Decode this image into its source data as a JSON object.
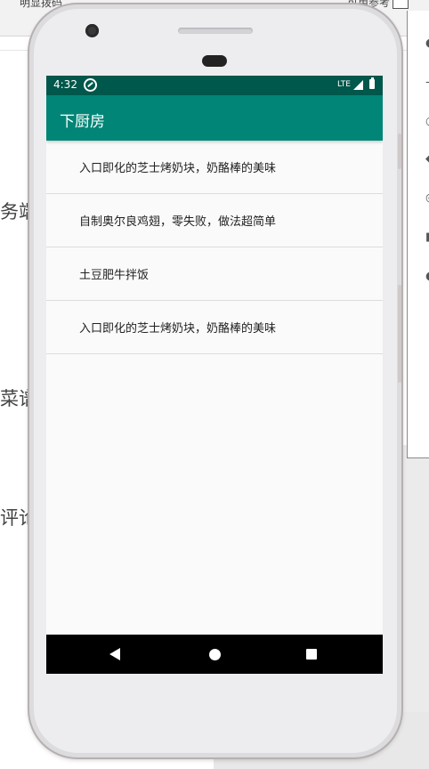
{
  "background": {
    "top_text_left": "明显拨码",
    "top_text_right": "可用参考",
    "words": [
      "务端",
      "菜谱",
      "评论"
    ]
  },
  "status_bar": {
    "time": "4:32",
    "network": "LTE"
  },
  "app_bar": {
    "title": "下厨房"
  },
  "recipes": [
    "入口即化的芝士烤奶块，奶酪棒的美味",
    "自制奥尔良鸡翅，零失败，做法超简单",
    "土豆肥牛拌饭",
    "入口即化的芝士烤奶块，奶酪棒的美味"
  ],
  "nav_bar": {
    "icons": [
      "back-icon",
      "home-icon",
      "recents-icon"
    ]
  }
}
